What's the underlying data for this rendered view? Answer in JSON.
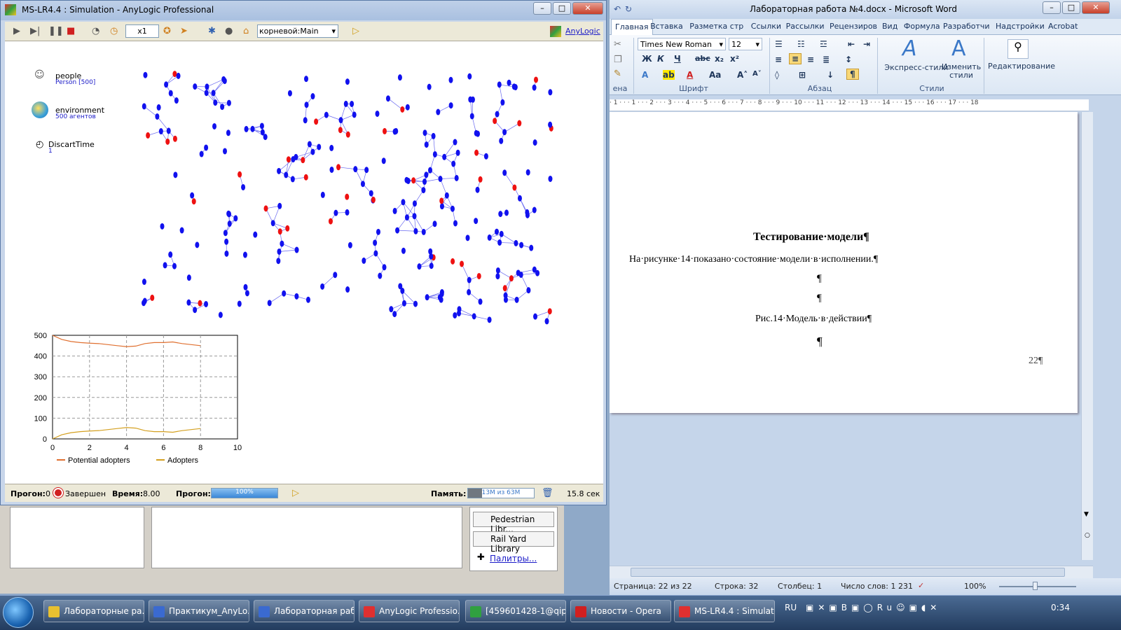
{
  "word": {
    "title": "Лабораторная работа №4.docx - Microsoft Word",
    "tabs": [
      "Главная",
      "Вставка",
      "Разметка стр",
      "Ссылки",
      "Рассылки",
      "Рецензиров",
      "Вид",
      "Формула",
      "Разработчи",
      "Надстройки",
      "Acrobat"
    ],
    "font_name": "Times New Roman",
    "font_size": "12",
    "group_font": "Шрифт",
    "group_paragraph": "Абзац",
    "group_styles": "Стили",
    "group_clipboard": "ена",
    "express_styles": "Экспресс-стили",
    "change_styles": "Изменить стили",
    "editing": "Редактирование",
    "ruler_text": "· 1 · · · 1 · · · 2 · · · 3 · · · 4 · · · 5 · · · 6 · · · 7 · · · 8 · · · 9 · · · 10 · · · 11 · · · 12 · · · 13 · · · 14 · · · 15 · · · 16 · · · 17 · · · 18",
    "doc_heading": "Тестирование·модели¶",
    "doc_para": "На·рисунке·14·показано·состояние·модели·в·исполнении.¶",
    "pilcrow": "¶",
    "caption": "Рис.14·Модель·в·действии¶",
    "page_number": "22¶",
    "status_page": "Страница: 22 из 22",
    "status_line": "Строка: 32",
    "status_col": "Столбец: 1",
    "status_words": "Число слов: 1 231",
    "zoom": "100%"
  },
  "anylogic_bg": {
    "pedestrian": "Pedestrian Libr...",
    "railyard": "Rail Yard Library",
    "palettes": "Палитры..."
  },
  "sim": {
    "title": "MS-LR4.4 : Simulation - AnyLogic Professional",
    "speed": "x1",
    "experiment": "корневой:Main",
    "brand": "AnyLogic",
    "params": [
      {
        "name": "people",
        "value": "Person [500]"
      },
      {
        "name": "environment",
        "value": "500 агентов"
      },
      {
        "name": "DiscartTime",
        "value": "1"
      }
    ],
    "status": {
      "run_label": "Прогон:",
      "run_value": "0",
      "state": "Завершен",
      "time_label": "Время:",
      "time_value": "8.00",
      "progress_label": "Прогон:",
      "progress_value": "100%",
      "progress_fraction": 1.0,
      "memory_label": "Память:",
      "memory_value": "13M из 63M",
      "memory_fraction": 0.21,
      "elapsed": "15.8 сек"
    }
  },
  "chart_data": {
    "type": "line",
    "title": "",
    "xlabel": "",
    "ylabel": "",
    "xlim": [
      0,
      10
    ],
    "ylim": [
      0,
      500
    ],
    "x_ticks": [
      0,
      2,
      4,
      6,
      8,
      10
    ],
    "y_ticks": [
      0,
      100,
      200,
      300,
      400,
      500
    ],
    "grid": true,
    "legend": "bottom",
    "x": [
      0,
      0.5,
      1,
      1.5,
      2,
      2.5,
      3,
      3.5,
      4,
      4.5,
      5,
      5.5,
      6,
      6.5,
      7,
      7.5,
      8
    ],
    "series": [
      {
        "name": "Potential adopters",
        "color": "#e07030",
        "values": [
          500,
          480,
          470,
          465,
          462,
          460,
          455,
          450,
          445,
          448,
          460,
          465,
          465,
          468,
          460,
          455,
          450
        ]
      },
      {
        "name": "Adopters",
        "color": "#d4a020",
        "values": [
          0,
          20,
          30,
          35,
          38,
          40,
          45,
          50,
          55,
          52,
          40,
          35,
          35,
          32,
          40,
          45,
          50
        ]
      }
    ]
  },
  "taskbar": {
    "items": [
      "Лабораторные ра...",
      "Практикум_AnyLo...",
      "Лабораторная раб...",
      "AnyLogic Professio...",
      "[459601428-1@qip....",
      "Новости - Opera",
      "MS-LR4.4 : Simulati..."
    ],
    "lang": "RU",
    "clock": "0:34"
  }
}
